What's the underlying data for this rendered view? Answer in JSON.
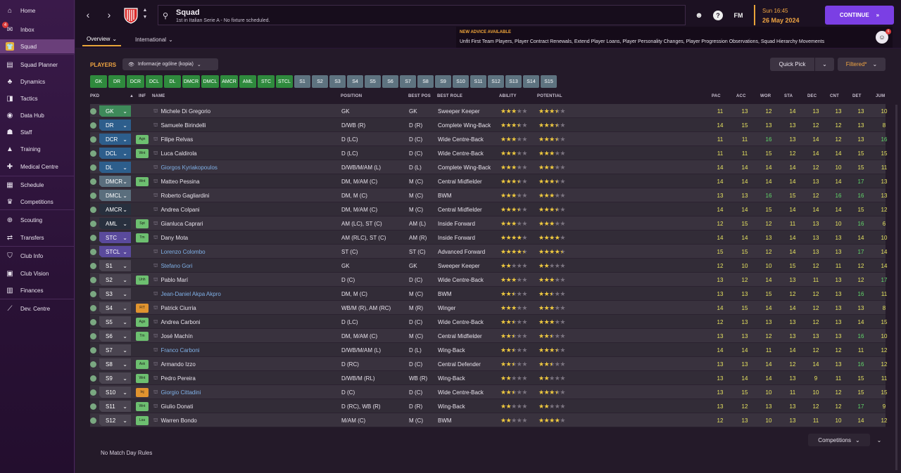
{
  "sidebar": {
    "items": [
      {
        "label": "Home",
        "icon": "home-icon",
        "glyph": "⌂"
      },
      {
        "label": "Inbox",
        "icon": "inbox-icon",
        "glyph": "✉",
        "badge": "4"
      },
      {
        "label": "Squad",
        "icon": "shirt-icon",
        "glyph": "👕",
        "active": true
      },
      {
        "label": "Squad Planner",
        "icon": "planner-icon",
        "glyph": "▤"
      },
      {
        "label": "Dynamics",
        "icon": "dynamics-icon",
        "glyph": "♣"
      },
      {
        "label": "Tactics",
        "icon": "tactics-icon",
        "glyph": "◨"
      },
      {
        "label": "Data Hub",
        "icon": "data-hub-icon",
        "glyph": "◉"
      },
      {
        "label": "Staff",
        "icon": "staff-icon",
        "glyph": "☗"
      },
      {
        "label": "Training",
        "icon": "training-icon",
        "glyph": "▲"
      },
      {
        "label": "Medical Centre",
        "icon": "medical-icon",
        "glyph": "✚"
      },
      {
        "label": "Schedule",
        "icon": "calendar-icon",
        "glyph": "▦"
      },
      {
        "label": "Competitions",
        "icon": "trophy-icon",
        "glyph": "♛"
      },
      {
        "label": "Scouting",
        "icon": "scouting-icon",
        "glyph": "⊕"
      },
      {
        "label": "Transfers",
        "icon": "transfers-icon",
        "glyph": "⇄"
      },
      {
        "label": "Club Info",
        "icon": "shield-icon",
        "glyph": "⛉"
      },
      {
        "label": "Club Vision",
        "icon": "vision-icon",
        "glyph": "▣"
      },
      {
        "label": "Finances",
        "icon": "finances-icon",
        "glyph": "▥"
      },
      {
        "label": "Dev. Centre",
        "icon": "dev-centre-icon",
        "glyph": "⟋"
      }
    ]
  },
  "header": {
    "title": "Squad",
    "subtitle": "1st in Italian Serie A - No fixture scheduled.",
    "fm_label": "FM",
    "time": "Sun 16:45",
    "date": "26 May 2024",
    "continue_label": "CONTINUE",
    "tabs": [
      {
        "label": "Overview"
      },
      {
        "label": "International"
      }
    ],
    "advice_title": "NEW ADVICE AVAILABLE",
    "advice_text": "Unfit First Team Players, Player Contract Renewals, Extend Player Loans, Player Personality Changes, Player Progression Observations, Squad Hierarchy Movements",
    "advice_count": "6"
  },
  "toolbar": {
    "players_label": "PLAYERS",
    "view_label": "Informacje ogólne (kopia)",
    "quick_pick": "Quick Pick",
    "filtered": "Filtered*"
  },
  "position_buttons": {
    "green": [
      "GK",
      "DR",
      "DCR",
      "DCL",
      "DL",
      "DMCR",
      "DMCL",
      "AMCR",
      "AML",
      "STC",
      "STCL"
    ],
    "grey": [
      "S1",
      "S2",
      "S3",
      "S4",
      "S5",
      "S6",
      "S7",
      "S8",
      "S9",
      "S10",
      "S11",
      "S12",
      "S13",
      "S14",
      "S15"
    ]
  },
  "columns": {
    "pkd": "PKD",
    "inf": "INF",
    "name": "NAME",
    "position": "POSITION",
    "best_pos": "BEST POS",
    "best_role": "BEST ROLE",
    "ability": "ABILITY",
    "potential": "POTENTIAL",
    "attrs": [
      "PAC",
      "ACC",
      "WOR",
      "STA",
      "DEC",
      "CNT",
      "DET",
      "JUM"
    ]
  },
  "colors": {
    "gk": "#3e8a5a",
    "def": "#2d5e8c",
    "dm": "#5a6e7d",
    "am": "#28303e",
    "st": "#5a4a9c",
    "sub": "#4a4450",
    "inf_green": "#6dbf70",
    "inf_orange": "#e0932f",
    "attr_yellow": "#e8e560",
    "attr_green": "#61d96a"
  },
  "players": [
    {
      "pos": "GK",
      "cat": "gk",
      "inf": "",
      "inf_color": "",
      "name": "Michele Di Gregorio",
      "link": false,
      "position": "GK",
      "best_pos": "GK",
      "best_role": "Sweeper Keeper",
      "ability": 3,
      "potential": 3.5,
      "attrs": [
        11,
        13,
        12,
        14,
        13,
        13,
        13,
        10
      ]
    },
    {
      "pos": "DR",
      "cat": "def",
      "inf": "",
      "inf_color": "",
      "name": "Samuele Birindelli",
      "link": false,
      "position": "D/WB (R)",
      "best_pos": "D (R)",
      "best_role": "Complete Wing-Back",
      "ability": 3.5,
      "potential": 3.5,
      "attrs": [
        14,
        15,
        13,
        13,
        12,
        12,
        13,
        8
      ]
    },
    {
      "pos": "DCR",
      "cat": "def",
      "inf": "Agn",
      "inf_color": "green",
      "name": "Filipe Relvas",
      "link": false,
      "position": "D (LC)",
      "best_pos": "D (C)",
      "best_role": "Wide Centre-Back",
      "ability": 3,
      "potential": 3.5,
      "attrs": [
        11,
        11,
        16,
        13,
        14,
        12,
        13,
        16
      ]
    },
    {
      "pos": "DCL",
      "cat": "def",
      "inf": "Wnt",
      "inf_color": "green",
      "name": "Luca Caldirola",
      "link": false,
      "position": "D (LC)",
      "best_pos": "D (C)",
      "best_role": "Wide Centre-Back",
      "ability": 3,
      "potential": 3,
      "attrs": [
        11,
        11,
        15,
        12,
        14,
        14,
        15,
        15
      ]
    },
    {
      "pos": "DL",
      "cat": "def",
      "inf": "",
      "inf_color": "",
      "name": "Giorgos Kyriakopoulos",
      "link": true,
      "position": "D/WB/M/AM (L)",
      "best_pos": "D (L)",
      "best_role": "Complete Wing-Back",
      "ability": 3,
      "potential": 3,
      "attrs": [
        14,
        14,
        14,
        14,
        12,
        10,
        15,
        11
      ]
    },
    {
      "pos": "DMCR",
      "cat": "dm",
      "inf": "Wnt",
      "inf_color": "green",
      "name": "Matteo Pessina",
      "link": false,
      "position": "DM, M/AM (C)",
      "best_pos": "M (C)",
      "best_role": "Central Midfielder",
      "ability": 3.5,
      "potential": 3.5,
      "attrs": [
        14,
        14,
        14,
        14,
        13,
        14,
        17,
        13
      ]
    },
    {
      "pos": "DMCL",
      "cat": "dm",
      "inf": "",
      "inf_color": "",
      "name": "Roberto Gagliardini",
      "link": false,
      "position": "DM, M (C)",
      "best_pos": "M (C)",
      "best_role": "BWM",
      "ability": 3,
      "potential": 3,
      "attrs": [
        13,
        13,
        16,
        15,
        12,
        16,
        16,
        13
      ]
    },
    {
      "pos": "AMCR",
      "cat": "am",
      "inf": "",
      "inf_color": "",
      "name": "Andrea Colpani",
      "link": false,
      "position": "DM, M/AM (C)",
      "best_pos": "M (C)",
      "best_role": "Central Midfielder",
      "ability": 3.5,
      "potential": 3.5,
      "attrs": [
        14,
        14,
        15,
        14,
        14,
        14,
        15,
        12
      ]
    },
    {
      "pos": "AML",
      "cat": "am",
      "inf": "Spt",
      "inf_color": "green",
      "name": "Gianluca Caprari",
      "link": false,
      "position": "AM (LC), ST (C)",
      "best_pos": "AM (L)",
      "best_role": "Inside Forward",
      "ability": 3,
      "potential": 3,
      "attrs": [
        12,
        15,
        12,
        11,
        13,
        10,
        16,
        6
      ]
    },
    {
      "pos": "STC",
      "cat": "st",
      "inf": "Tm",
      "inf_color": "green",
      "name": "Dany Mota",
      "link": false,
      "position": "AM (RLC), ST (C)",
      "best_pos": "AM (R)",
      "best_role": "Inside Forward",
      "ability": 4,
      "potential": 4,
      "attrs": [
        14,
        14,
        13,
        14,
        13,
        13,
        14,
        10
      ]
    },
    {
      "pos": "STCL",
      "cat": "st",
      "inf": "",
      "inf_color": "",
      "name": "Lorenzo Colombo",
      "link": true,
      "position": "ST (C)",
      "best_pos": "ST (C)",
      "best_role": "Advanced Forward",
      "ability": 4.5,
      "potential": 4.5,
      "attrs": [
        15,
        15,
        12,
        14,
        13,
        13,
        17,
        14
      ]
    },
    {
      "pos": "S1",
      "cat": "sub",
      "inf": "",
      "inf_color": "",
      "name": "Stefano Gori",
      "link": true,
      "position": "GK",
      "best_pos": "GK",
      "best_role": "Sweeper Keeper",
      "ability": 2,
      "potential": 2,
      "attrs": [
        12,
        10,
        10,
        15,
        12,
        11,
        12,
        14
      ]
    },
    {
      "pos": "S2",
      "cat": "sub",
      "inf": "Unh",
      "inf_color": "green",
      "name": "Pablo Marí",
      "link": false,
      "position": "D (C)",
      "best_pos": "D (C)",
      "best_role": "Wide Centre-Back",
      "ability": 3,
      "potential": 3,
      "attrs": [
        13,
        12,
        14,
        13,
        11,
        13,
        12,
        17
      ]
    },
    {
      "pos": "S3",
      "cat": "sub",
      "inf": "",
      "inf_color": "",
      "name": "Jean-Daniel Akpa Akpro",
      "link": true,
      "position": "DM, M (C)",
      "best_pos": "M (C)",
      "best_role": "BWM",
      "ability": 2.5,
      "potential": 2.5,
      "attrs": [
        13,
        13,
        15,
        12,
        12,
        13,
        16,
        11
      ]
    },
    {
      "pos": "S4",
      "cat": "sub",
      "inf": "FIT",
      "inf_color": "orange",
      "name": "Patrick Ciurria",
      "link": false,
      "position": "WB/M (R), AM (RC)",
      "best_pos": "M (R)",
      "best_role": "Winger",
      "ability": 3,
      "potential": 3,
      "attrs": [
        14,
        15,
        14,
        14,
        12,
        13,
        13,
        8
      ]
    },
    {
      "pos": "S5",
      "cat": "sub",
      "inf": "Agn",
      "inf_color": "green",
      "name": "Andrea Carboni",
      "link": false,
      "position": "D (LC)",
      "best_pos": "D (C)",
      "best_role": "Wide Centre-Back",
      "ability": 2.5,
      "potential": 3,
      "attrs": [
        12,
        13,
        13,
        13,
        12,
        13,
        14,
        15
      ]
    },
    {
      "pos": "S6",
      "cat": "sub",
      "inf": "Tm",
      "inf_color": "green",
      "name": "José Machín",
      "link": false,
      "position": "DM, M/AM (C)",
      "best_pos": "M (C)",
      "best_role": "Central Midfielder",
      "ability": 2.5,
      "potential": 2.5,
      "attrs": [
        13,
        13,
        12,
        13,
        13,
        13,
        16,
        10
      ]
    },
    {
      "pos": "S7",
      "cat": "sub",
      "inf": "",
      "inf_color": "",
      "name": "Franco Carboni",
      "link": true,
      "position": "D/WB/M/AM (L)",
      "best_pos": "D (L)",
      "best_role": "Wing-Back",
      "ability": 2.5,
      "potential": 3.5,
      "pot_white": true,
      "attrs": [
        14,
        14,
        11,
        14,
        12,
        12,
        11,
        12
      ]
    },
    {
      "pos": "S8",
      "cat": "sub",
      "inf": "Ask",
      "inf_color": "green",
      "name": "Armando Izzo",
      "link": false,
      "position": "D (RC)",
      "best_pos": "D (C)",
      "best_role": "Central Defender",
      "ability": 2.5,
      "potential": 2.5,
      "attrs": [
        13,
        13,
        14,
        12,
        14,
        13,
        16,
        12
      ]
    },
    {
      "pos": "S9",
      "cat": "sub",
      "inf": "Wnt",
      "inf_color": "green",
      "name": "Pedro Pereira",
      "link": false,
      "position": "D/WB/M (RL)",
      "best_pos": "WB (R)",
      "best_role": "Wing-Back",
      "ability": 2,
      "potential": 2,
      "attrs": [
        13,
        14,
        14,
        13,
        9,
        11,
        15,
        11
      ]
    },
    {
      "pos": "S10",
      "cat": "sub",
      "inf": "Inj",
      "inf_color": "orange",
      "name": "Giorgio Cittadini",
      "link": true,
      "position": "D (C)",
      "best_pos": "D (C)",
      "best_role": "Wide Centre-Back",
      "ability": 2.5,
      "potential": 3.5,
      "attrs": [
        13,
        15,
        10,
        11,
        10,
        12,
        15,
        15
      ]
    },
    {
      "pos": "S11",
      "cat": "sub",
      "inf": "Wnt",
      "inf_color": "green",
      "name": "Giulio Donati",
      "link": false,
      "position": "D (RC), WB (R)",
      "best_pos": "D (R)",
      "best_role": "Wing-Back",
      "ability": 2,
      "potential": 2,
      "attrs": [
        13,
        12,
        13,
        13,
        12,
        12,
        17,
        9
      ]
    },
    {
      "pos": "S12",
      "cat": "sub",
      "inf": "Lsa",
      "inf_color": "green",
      "name": "Warren Bondo",
      "link": false,
      "position": "M/AM (C)",
      "best_pos": "M (C)",
      "best_role": "BWM",
      "ability": 2,
      "potential": 4,
      "pot_white": true,
      "attrs": [
        12,
        13,
        10,
        13,
        11,
        10,
        14,
        12
      ]
    }
  ],
  "footer": {
    "competitions": "Competitions",
    "no_match_day": "No Match Day Rules"
  }
}
